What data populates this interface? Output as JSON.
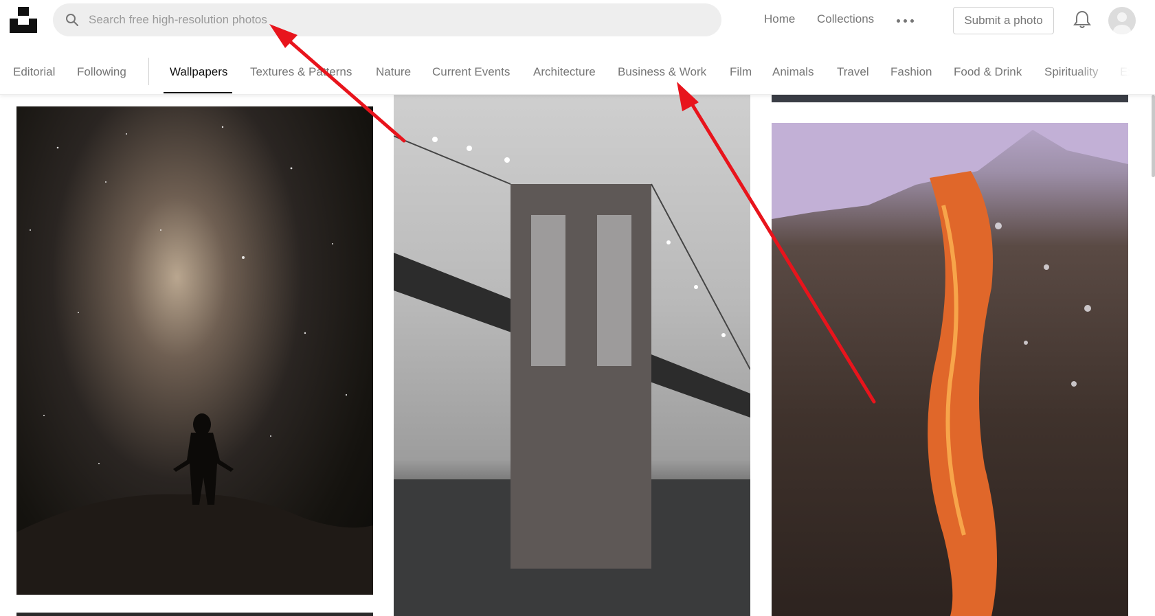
{
  "header": {
    "logo_icon": "unsplash-logo-icon",
    "search": {
      "placeholder": "Search free high-resolution photos",
      "value": "",
      "icon": "search-icon"
    },
    "nav": {
      "home": "Home",
      "collections": "Collections",
      "more_icon": "more-dots-icon"
    },
    "submit_label": "Submit a photo",
    "bell_icon": "bell-icon",
    "avatar_icon": "user-avatar-icon"
  },
  "categories": {
    "items": [
      {
        "label": "Editorial",
        "active": false
      },
      {
        "label": "Following",
        "active": false
      },
      {
        "label": "Wallpapers",
        "active": true
      },
      {
        "label": "Textures & Patterns",
        "active": false
      },
      {
        "label": "Nature",
        "active": false
      },
      {
        "label": "Current Events",
        "active": false
      },
      {
        "label": "Architecture",
        "active": false
      },
      {
        "label": "Business & Work",
        "active": false
      },
      {
        "label": "Film",
        "active": false
      },
      {
        "label": "Animals",
        "active": false
      },
      {
        "label": "Travel",
        "active": false
      },
      {
        "label": "Fashion",
        "active": false
      },
      {
        "label": "Food & Drink",
        "active": false
      },
      {
        "label": "Spirituality",
        "active": false
      },
      {
        "label": "Expe",
        "active": false
      }
    ]
  },
  "photos": [
    {
      "subject": "milky-way-silhouette-photo"
    },
    {
      "subject": "foggy-bridge-photo"
    },
    {
      "subject": "firefall-cliff-photo"
    }
  ],
  "colors": {
    "accent_text": "#111111",
    "muted_text": "#767676",
    "search_bg": "#eeeeee",
    "annotation_arrow": "#e8141c"
  }
}
